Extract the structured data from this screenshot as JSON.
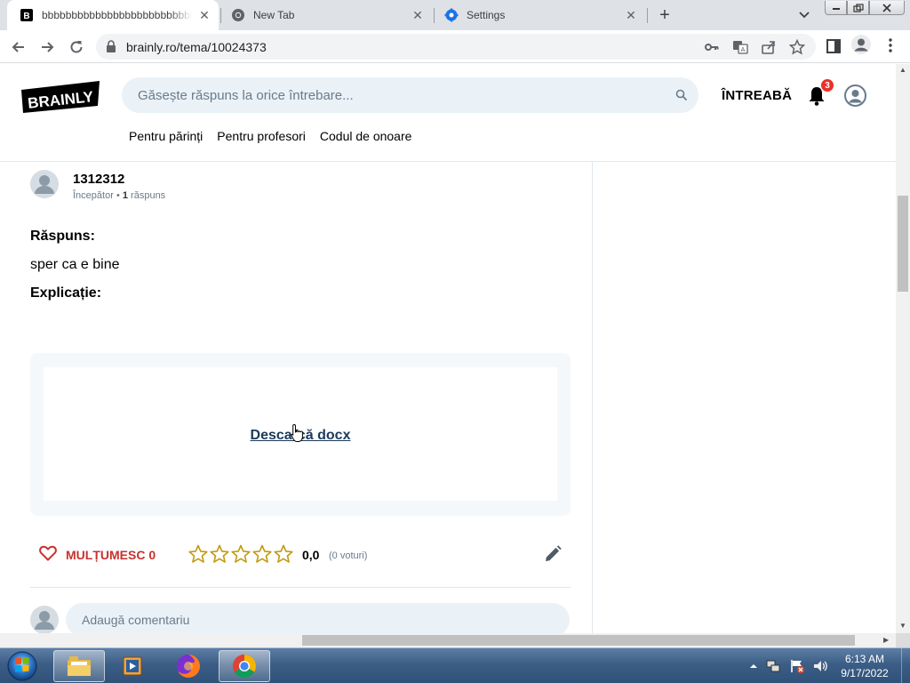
{
  "browser": {
    "tabs": [
      {
        "title": "bbbbbbbbbbbbbbbbbbbbbbbbbbbb",
        "favicon": "brainly-favicon",
        "active": true
      },
      {
        "title": "New Tab",
        "favicon": "chrome-icon",
        "active": false
      },
      {
        "title": "Settings",
        "favicon": "settings-gear-icon",
        "active": false
      }
    ],
    "url": "brainly.ro/tema/10024373",
    "close_glyph": "✕",
    "new_tab_glyph": "+"
  },
  "site": {
    "logo_text": "BRAINLY",
    "search_placeholder": "Găsește răspuns la orice întrebare...",
    "ask_label": "ÎNTREABĂ",
    "notification_count": "3",
    "subnav": [
      "Pentru părinți",
      "Pentru profesori",
      "Codul de onoare"
    ]
  },
  "answer": {
    "username": "1312312",
    "rank": "Începător",
    "answers_count": "1",
    "answers_word": "răspuns",
    "answer_label": "Răspuns:",
    "answer_text": "sper ca e bine",
    "explanation_label": "Explicație:",
    "download_label": "Descarcă docx",
    "thanks_label": "MULȚUMESC",
    "thanks_count": "0",
    "rating_value": "0,0",
    "rating_votes": "(0 voturi)",
    "rating_stars": 0,
    "comment_placeholder": "Adaugă comentariu"
  },
  "taskbar": {
    "time": "6:13 AM",
    "date": "9/17/2022"
  },
  "colors": {
    "brand_red": "#c9322c",
    "search_bg": "#ebf2f7",
    "star_gold": "#c29a0c"
  }
}
